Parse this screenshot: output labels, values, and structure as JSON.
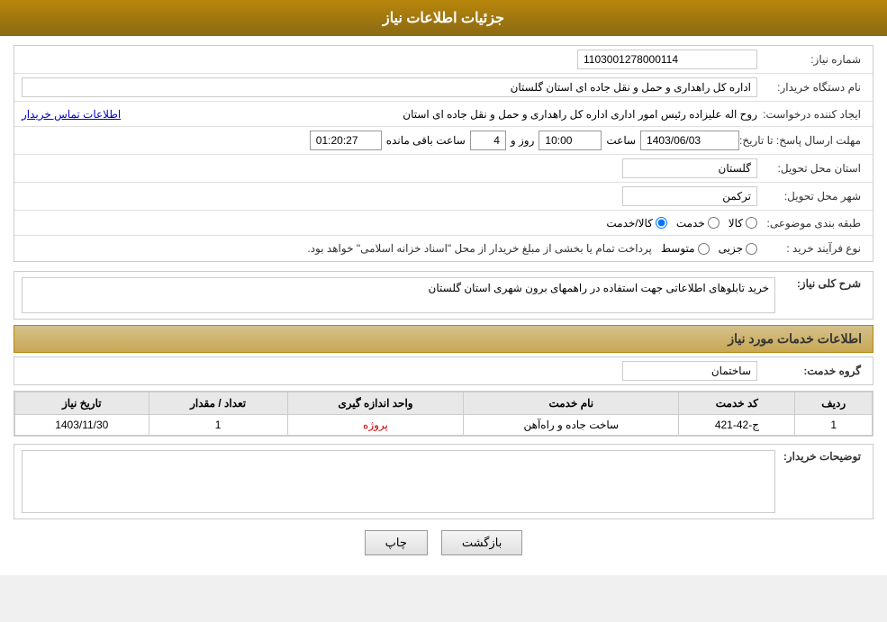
{
  "header": {
    "title": "جزئیات اطلاعات نیاز"
  },
  "form": {
    "fields": [
      {
        "label": "شماره نیاز:",
        "value": "1103001278000114",
        "type": "text-value",
        "align": "ltr"
      },
      {
        "label": "نام دستگاه خریدار:",
        "value": "اداره کل راهداری و حمل و نقل جاده ای استان گلستان",
        "type": "text-value"
      },
      {
        "label": "ایجاد کننده درخواست:",
        "value": "روح اله علیزاده رئیس امور اداری اداره کل راهداری و حمل و نقل جاده ای استان",
        "extra": "اطلاعات تماس خریدار",
        "type": "text-link"
      },
      {
        "label": "مهلت ارسال پاسخ: تا تاریخ:",
        "type": "date-row",
        "date": "1403/06/03",
        "time_label": "ساعت",
        "time": "10:00",
        "day_label": "روز و",
        "days": "4",
        "remain_label": "ساعت باقی مانده",
        "remain": "01:20:27"
      },
      {
        "label": "استان محل تحویل:",
        "value": "گلستان",
        "type": "text-value"
      },
      {
        "label": "شهر محل تحویل:",
        "value": "ترکمن",
        "type": "text-value"
      },
      {
        "label": "طبقه بندی موضوعی:",
        "type": "radio",
        "options": [
          "کالا",
          "خدمت",
          "کالا/خدمت"
        ]
      },
      {
        "label": "نوع فرآیند خرید :",
        "type": "radio-process",
        "options": [
          "جزیی",
          "متوسط"
        ],
        "note": "پرداخت تمام یا بخشی از مبلغ خریدار از محل \"اسناد خزانه اسلامی\" خواهد بود."
      }
    ]
  },
  "sharh": {
    "label": "شرح کلی نیاز:",
    "value": "خرید تابلوهای اطلاعاتی جهت استفاده در راهمهای برون شهری استان گلستان"
  },
  "services_section": {
    "title": "اطلاعات خدمات مورد نیاز"
  },
  "group_service": {
    "label": "گروه خدمت:",
    "value": "ساختمان"
  },
  "table": {
    "headers": [
      "ردیف",
      "کد خدمت",
      "نام خدمت",
      "واحد اندازه گیری",
      "تعداد / مقدار",
      "تاریخ نیاز"
    ],
    "rows": [
      {
        "id": "1",
        "code": "ج-42-421",
        "name": "ساخت جاده و راه‌آهن",
        "unit": "پروژه",
        "qty": "1",
        "date": "1403/11/30"
      }
    ]
  },
  "buyer_desc": {
    "label": "توضیحات خریدار:",
    "value": ""
  },
  "buttons": {
    "print": "چاپ",
    "back": "بازگشت"
  }
}
